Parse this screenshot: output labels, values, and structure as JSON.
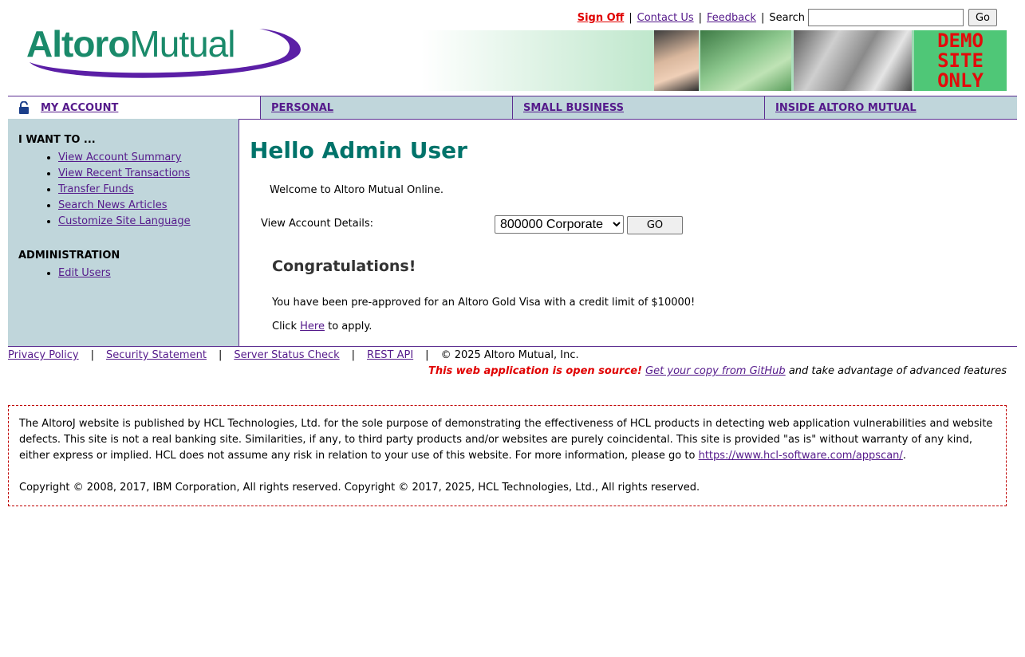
{
  "header": {
    "sign_off": "Sign Off",
    "contact_us": "Contact Us",
    "feedback": "Feedback",
    "search_label": "Search",
    "search_value": "",
    "search_go": "Go",
    "logo_text_1": "Altoro",
    "logo_text_2": "Mutual",
    "banner_demo": [
      "DEMO",
      "SITE",
      "ONLY"
    ]
  },
  "tabs": [
    {
      "label": "MY ACCOUNT",
      "icon": "lock-icon",
      "active": true
    },
    {
      "label": "PERSONAL"
    },
    {
      "label": "SMALL BUSINESS"
    },
    {
      "label": "INSIDE ALTORO MUTUAL"
    }
  ],
  "sidebar": {
    "i_want_heading": "I WANT TO ...",
    "i_want_items": [
      "View Account Summary",
      "View Recent Transactions",
      "Transfer Funds",
      "Search News Articles",
      "Customize Site Language"
    ],
    "admin_heading": "ADMINISTRATION",
    "admin_items": [
      "Edit Users"
    ]
  },
  "main": {
    "greeting": "Hello Admin User",
    "welcome": "Welcome to Altoro Mutual Online.",
    "view_account_label": "View Account Details:",
    "account_selected": "800000 Corporate",
    "go_label": "GO",
    "congrats_heading": "Congratulations!",
    "preapproved_text": "You have been pre-approved for an Altoro Gold Visa with a credit limit of $10000!",
    "click_prefix": "Click",
    "click_link": "Here",
    "click_suffix": "to apply."
  },
  "footer": {
    "links": [
      "Privacy Policy",
      "Security Statement",
      "Server Status Check",
      "REST API"
    ],
    "copyright": "© 2025 Altoro Mutual, Inc.",
    "opensource_red": "This web application is open source!",
    "github_link": "Get your copy from GitHub",
    "opensource_tail": "and take advantage of advanced features"
  },
  "disclaimer": {
    "text": "The AltoroJ website is published by HCL Technologies, Ltd. for the sole purpose of demonstrating the effectiveness of HCL products in detecting web application vulnerabilities and website defects. This site is not a real banking site. Similarities, if any, to third party products and/or websites are purely coincidental. This site is provided \"as is\" without warranty of any kind, either express or implied. HCL does not assume any risk in relation to your use of this website. For more information, please go to",
    "link": "https://www.hcl-software.com/appscan/",
    "link_suffix": ".",
    "copyright": "Copyright © 2008, 2017, IBM Corporation, All rights reserved. Copyright © 2017, 2025, HCL Technologies, Ltd., All rights reserved."
  },
  "colors": {
    "accent_teal": "#00736a",
    "nav_bg": "#c0d6db",
    "border_purple": "#5c2e91",
    "link": "#551a8b",
    "alert_red": "#e00000"
  }
}
